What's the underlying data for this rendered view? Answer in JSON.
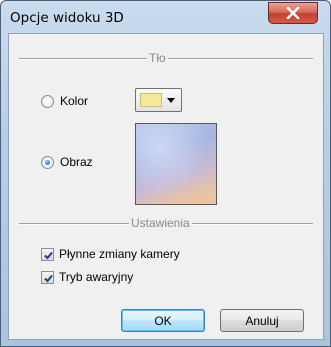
{
  "window": {
    "title": "Opcje widoku 3D"
  },
  "groups": {
    "background": {
      "label": "Tło"
    },
    "settings": {
      "label": "Ustawienia"
    }
  },
  "background": {
    "color_option": {
      "label": "Kolor",
      "checked": false
    },
    "image_option": {
      "label": "Obraz",
      "checked": true
    },
    "selected_color": "#f4e99a"
  },
  "settings": {
    "smooth_camera": {
      "label": "Płynne zmiany kamery",
      "checked": true
    },
    "fallback_mode": {
      "label": "Tryb awaryjny",
      "checked": true
    }
  },
  "buttons": {
    "ok": "OK",
    "cancel": "Anuluj"
  }
}
